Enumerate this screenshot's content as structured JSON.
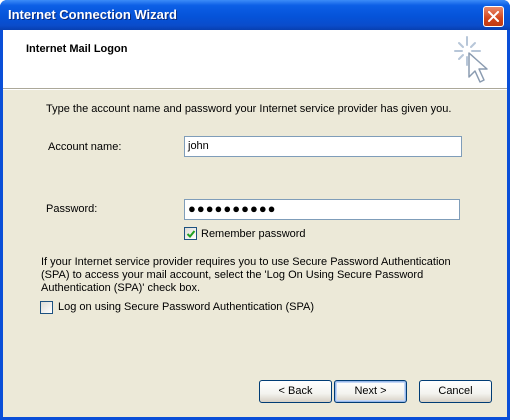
{
  "window": {
    "title": "Internet Connection Wizard"
  },
  "header": {
    "title": "Internet Mail Logon",
    "icon": "wizard-wand-cursor-icon"
  },
  "content": {
    "instruction": "Type the account name and password your Internet service provider has given you.",
    "account_label": "Account name:",
    "account_value": "john",
    "password_label": "Password:",
    "password_masked": "●●●●●●●●●●",
    "remember_label": "Remember password",
    "remember_checked": true,
    "spa_text": [
      "If your Internet service provider requires you to use Secure Password Authentication",
      "(SPA) to access your mail account, select the 'Log On Using Secure Password",
      "Authentication (SPA)' check box."
    ],
    "spa_label": "Log on using Secure Password Authentication (SPA)",
    "spa_checked": false
  },
  "buttons": {
    "back": "< Back",
    "next": "Next >",
    "cancel": "Cancel"
  },
  "colors": {
    "titlebar": "#0553d9",
    "dialog_bg": "#ece9d8",
    "checkmark": "#21a121"
  }
}
